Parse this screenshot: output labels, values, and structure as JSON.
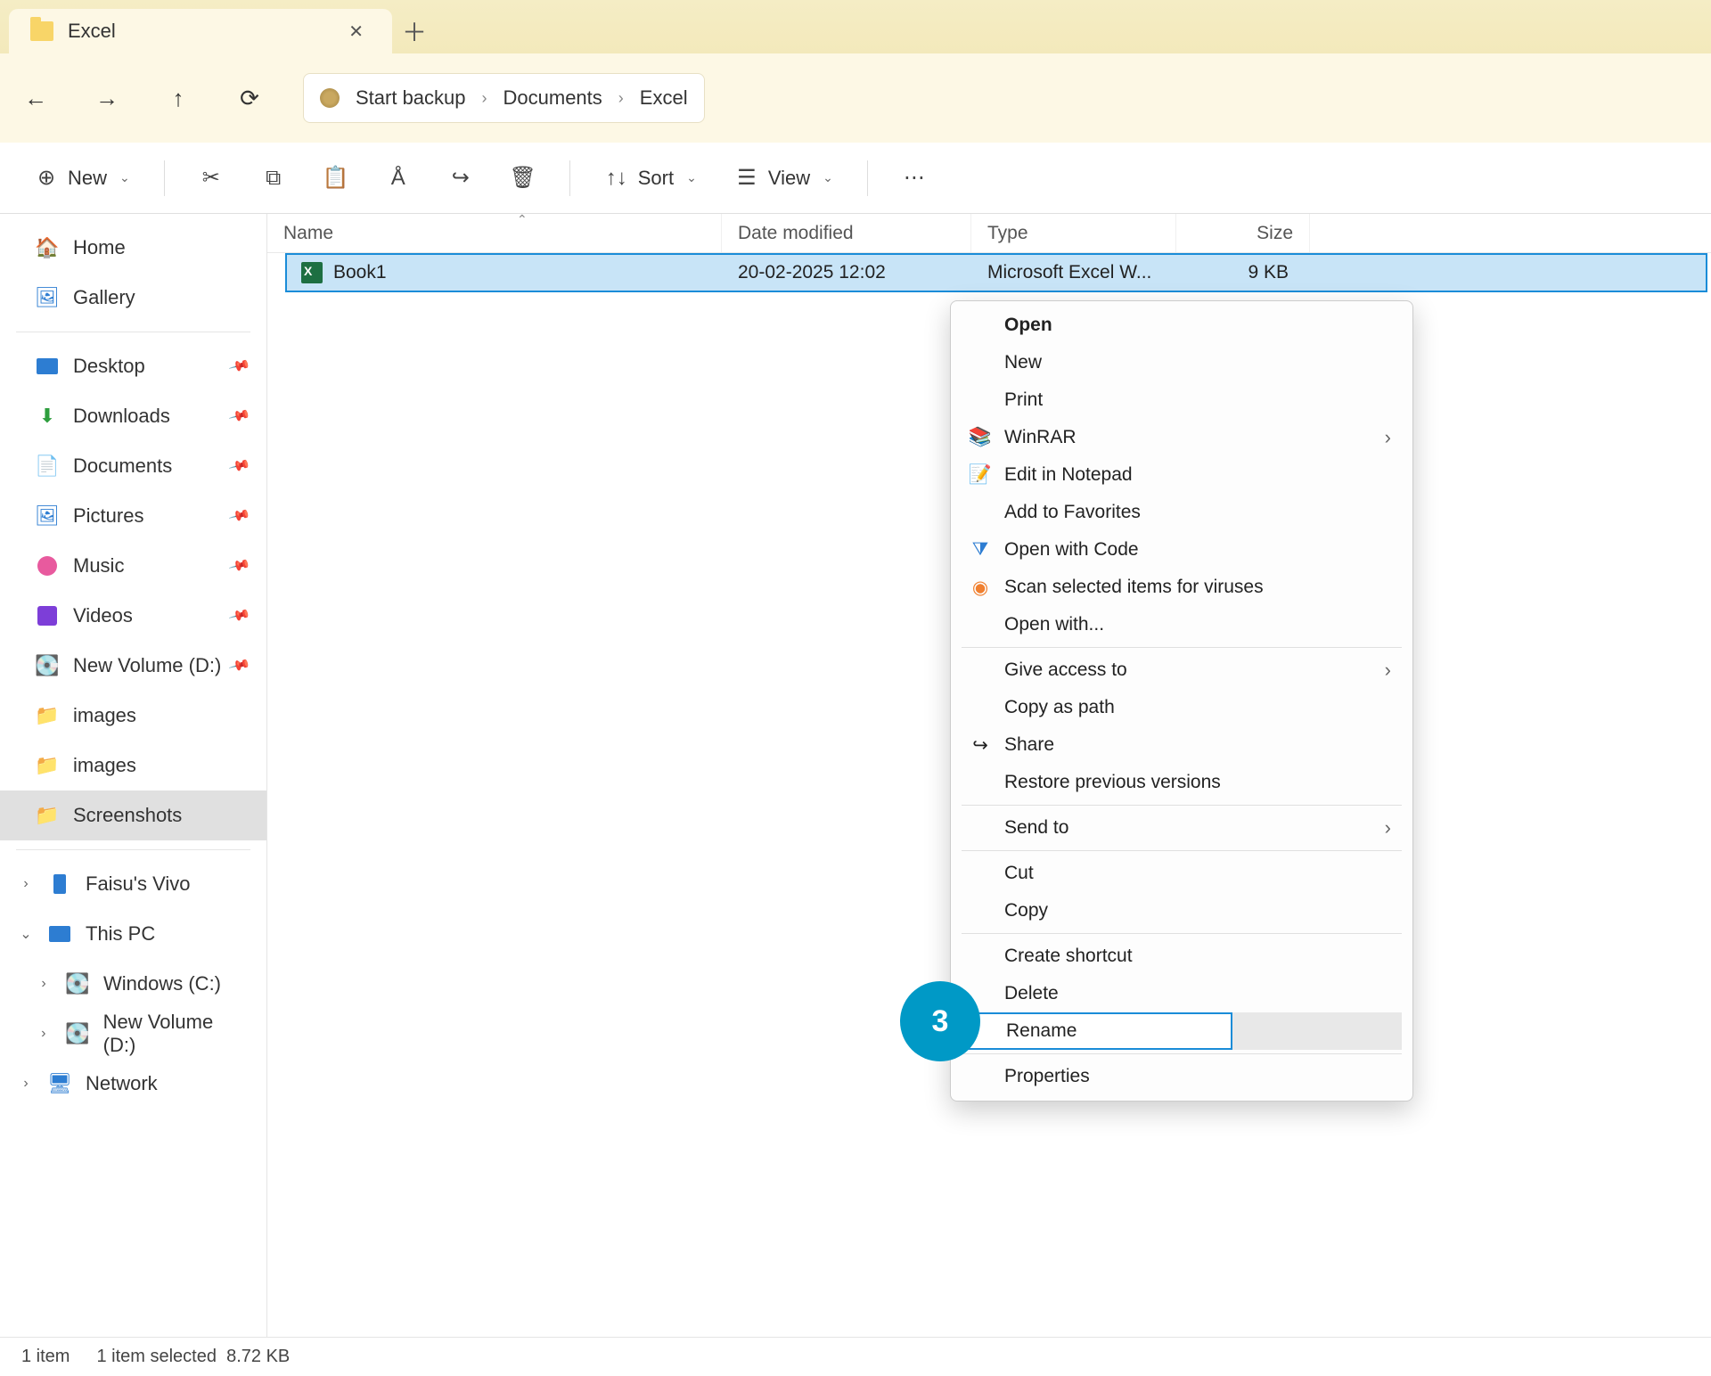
{
  "tab": {
    "title": "Excel"
  },
  "breadcrumb": {
    "root": "Start backup",
    "items": [
      "Documents",
      "Excel"
    ]
  },
  "toolbar": {
    "new": "New",
    "sort": "Sort",
    "view": "View"
  },
  "columns": {
    "name": "Name",
    "date": "Date modified",
    "type": "Type",
    "size": "Size"
  },
  "file": {
    "name": "Book1",
    "date": "20-02-2025 12:02",
    "type": "Microsoft Excel W...",
    "size": "9 KB"
  },
  "sidebar": {
    "home": "Home",
    "gallery": "Gallery",
    "desktop": "Desktop",
    "downloads": "Downloads",
    "documents": "Documents",
    "pictures": "Pictures",
    "music": "Music",
    "videos": "Videos",
    "newvol_d": "New Volume (D:)",
    "images1": "images",
    "images2": "images",
    "screenshots": "Screenshots",
    "faisu": "Faisu's Vivo",
    "thispc": "This PC",
    "windows_c": "Windows (C:)",
    "newvol_d2": "New Volume (D:)",
    "network": "Network"
  },
  "context_menu": {
    "open": "Open",
    "new": "New",
    "print": "Print",
    "winrar": "WinRAR",
    "edit_notepad": "Edit in Notepad",
    "add_fav": "Add to Favorites",
    "open_code": "Open with Code",
    "scan_virus": "Scan selected items for viruses",
    "open_with": "Open with...",
    "give_access": "Give access to",
    "copy_path": "Copy as path",
    "share": "Share",
    "restore": "Restore previous versions",
    "send_to": "Send to",
    "cut": "Cut",
    "copy": "Copy",
    "shortcut": "Create shortcut",
    "delete": "Delete",
    "rename": "Rename",
    "properties": "Properties"
  },
  "annotation": {
    "number": "3"
  },
  "status": {
    "count": "1 item",
    "selected": "1 item selected",
    "size": "8.72 KB"
  }
}
